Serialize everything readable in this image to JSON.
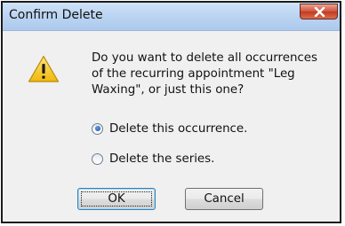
{
  "window": {
    "title": "Confirm Delete",
    "close_icon": "close-x-icon"
  },
  "dialog": {
    "icon": "warning-icon",
    "message_lines": [
      "Do you want to delete all occurrences",
      "of the recurring appointment \"Leg",
      "Waxing\", or just this one?"
    ],
    "options": [
      {
        "label": "Delete this occurrence.",
        "checked": true
      },
      {
        "label": "Delete the series.",
        "checked": false
      }
    ],
    "ok_label": "OK",
    "cancel_label": "Cancel"
  },
  "colors": {
    "titlebar": "#b9d3f1",
    "close_button": "#c23a22",
    "dialog_background": "#f0f0f0",
    "warning_icon": "#f2c21b"
  }
}
